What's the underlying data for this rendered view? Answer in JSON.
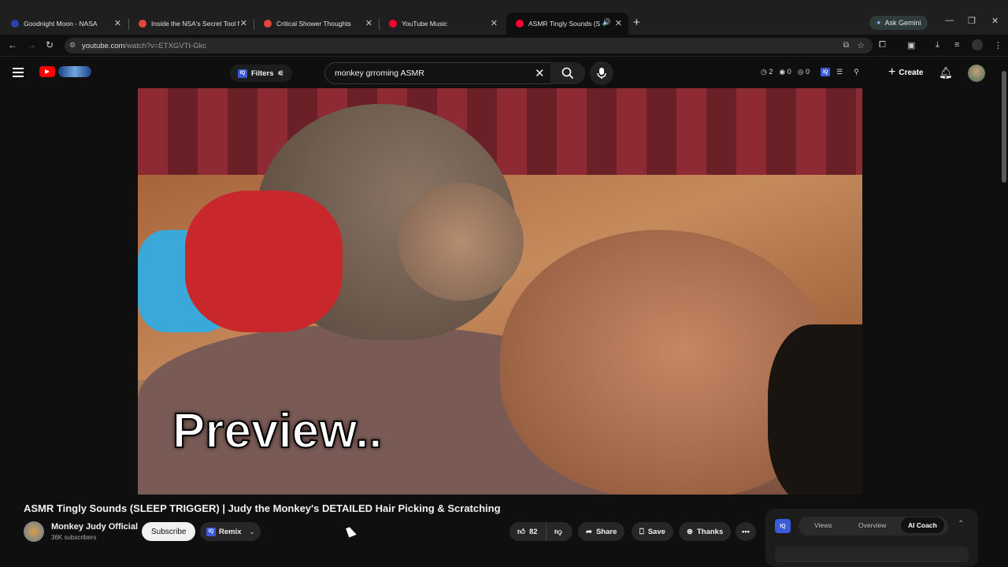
{
  "browser": {
    "tabs": [
      {
        "title": "Goodnight Moon - NASA",
        "favicon_color": "#2d3fa8"
      },
      {
        "title": "Inside the NSA's Secret Tool for",
        "favicon_color": "#e0483c"
      },
      {
        "title": "Critical Shower Thoughts",
        "favicon_color": "#e0483c"
      },
      {
        "title": "YouTube Music",
        "favicon_color": "#ff0033"
      },
      {
        "title": "ASMR Tingly Sounds (SLEEP",
        "favicon_color": "#ff0033",
        "active": true
      }
    ],
    "ask_gemini": "Ask Gemini",
    "url_host": "youtube.com",
    "url_path": "/watch?v=ETXGVTt-Gkc"
  },
  "header": {
    "filters_label": "Filters",
    "search_query": "monkey grroming ASMR",
    "stats": [
      "2",
      "0",
      "0"
    ],
    "create_label": "Create",
    "iq_label": "IQ"
  },
  "video": {
    "caption": "Preview..",
    "title": "ASMR Tingly Sounds (SLEEP TRIGGER) | Judy the Monkey's DETAILED Hair Picking & Scratching",
    "channel": "Monkey Judy Official",
    "subscribers": "36K subscribers",
    "subscribe_label": "Subscribe",
    "remix_label": "Remix",
    "likes": "82",
    "share_label": "Share",
    "save_label": "Save",
    "thanks_label": "Thanks"
  },
  "side_panel": {
    "tabs": [
      "Views",
      "Overview",
      "AI Coach"
    ],
    "active_tab": "AI Coach"
  },
  "colors": {
    "accent": "#ff0000",
    "iq_blue": "#3b5bdb"
  }
}
